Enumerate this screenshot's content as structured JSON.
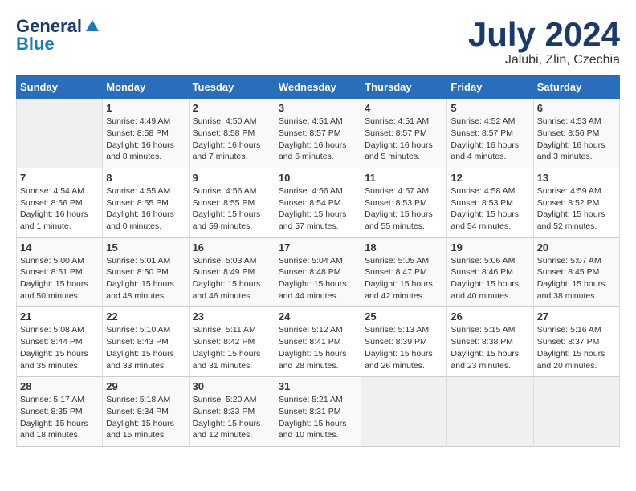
{
  "logo": {
    "general": "General",
    "blue": "Blue"
  },
  "title": "July 2024",
  "location": "Jalubi, Zlin, Czechia",
  "days_of_week": [
    "Sunday",
    "Monday",
    "Tuesday",
    "Wednesday",
    "Thursday",
    "Friday",
    "Saturday"
  ],
  "weeks": [
    [
      {
        "day": "",
        "info": ""
      },
      {
        "day": "1",
        "info": "Sunrise: 4:49 AM\nSunset: 8:58 PM\nDaylight: 16 hours\nand 8 minutes."
      },
      {
        "day": "2",
        "info": "Sunrise: 4:50 AM\nSunset: 8:58 PM\nDaylight: 16 hours\nand 7 minutes."
      },
      {
        "day": "3",
        "info": "Sunrise: 4:51 AM\nSunset: 8:57 PM\nDaylight: 16 hours\nand 6 minutes."
      },
      {
        "day": "4",
        "info": "Sunrise: 4:51 AM\nSunset: 8:57 PM\nDaylight: 16 hours\nand 5 minutes."
      },
      {
        "day": "5",
        "info": "Sunrise: 4:52 AM\nSunset: 8:57 PM\nDaylight: 16 hours\nand 4 minutes."
      },
      {
        "day": "6",
        "info": "Sunrise: 4:53 AM\nSunset: 8:56 PM\nDaylight: 16 hours\nand 3 minutes."
      }
    ],
    [
      {
        "day": "7",
        "info": "Sunrise: 4:54 AM\nSunset: 8:56 PM\nDaylight: 16 hours\nand 1 minute."
      },
      {
        "day": "8",
        "info": "Sunrise: 4:55 AM\nSunset: 8:55 PM\nDaylight: 16 hours\nand 0 minutes."
      },
      {
        "day": "9",
        "info": "Sunrise: 4:56 AM\nSunset: 8:55 PM\nDaylight: 15 hours\nand 59 minutes."
      },
      {
        "day": "10",
        "info": "Sunrise: 4:56 AM\nSunset: 8:54 PM\nDaylight: 15 hours\nand 57 minutes."
      },
      {
        "day": "11",
        "info": "Sunrise: 4:57 AM\nSunset: 8:53 PM\nDaylight: 15 hours\nand 55 minutes."
      },
      {
        "day": "12",
        "info": "Sunrise: 4:58 AM\nSunset: 8:53 PM\nDaylight: 15 hours\nand 54 minutes."
      },
      {
        "day": "13",
        "info": "Sunrise: 4:59 AM\nSunset: 8:52 PM\nDaylight: 15 hours\nand 52 minutes."
      }
    ],
    [
      {
        "day": "14",
        "info": "Sunrise: 5:00 AM\nSunset: 8:51 PM\nDaylight: 15 hours\nand 50 minutes."
      },
      {
        "day": "15",
        "info": "Sunrise: 5:01 AM\nSunset: 8:50 PM\nDaylight: 15 hours\nand 48 minutes."
      },
      {
        "day": "16",
        "info": "Sunrise: 5:03 AM\nSunset: 8:49 PM\nDaylight: 15 hours\nand 46 minutes."
      },
      {
        "day": "17",
        "info": "Sunrise: 5:04 AM\nSunset: 8:48 PM\nDaylight: 15 hours\nand 44 minutes."
      },
      {
        "day": "18",
        "info": "Sunrise: 5:05 AM\nSunset: 8:47 PM\nDaylight: 15 hours\nand 42 minutes."
      },
      {
        "day": "19",
        "info": "Sunrise: 5:06 AM\nSunset: 8:46 PM\nDaylight: 15 hours\nand 40 minutes."
      },
      {
        "day": "20",
        "info": "Sunrise: 5:07 AM\nSunset: 8:45 PM\nDaylight: 15 hours\nand 38 minutes."
      }
    ],
    [
      {
        "day": "21",
        "info": "Sunrise: 5:08 AM\nSunset: 8:44 PM\nDaylight: 15 hours\nand 35 minutes."
      },
      {
        "day": "22",
        "info": "Sunrise: 5:10 AM\nSunset: 8:43 PM\nDaylight: 15 hours\nand 33 minutes."
      },
      {
        "day": "23",
        "info": "Sunrise: 5:11 AM\nSunset: 8:42 PM\nDaylight: 15 hours\nand 31 minutes."
      },
      {
        "day": "24",
        "info": "Sunrise: 5:12 AM\nSunset: 8:41 PM\nDaylight: 15 hours\nand 28 minutes."
      },
      {
        "day": "25",
        "info": "Sunrise: 5:13 AM\nSunset: 8:39 PM\nDaylight: 15 hours\nand 26 minutes."
      },
      {
        "day": "26",
        "info": "Sunrise: 5:15 AM\nSunset: 8:38 PM\nDaylight: 15 hours\nand 23 minutes."
      },
      {
        "day": "27",
        "info": "Sunrise: 5:16 AM\nSunset: 8:37 PM\nDaylight: 15 hours\nand 20 minutes."
      }
    ],
    [
      {
        "day": "28",
        "info": "Sunrise: 5:17 AM\nSunset: 8:35 PM\nDaylight: 15 hours\nand 18 minutes."
      },
      {
        "day": "29",
        "info": "Sunrise: 5:18 AM\nSunset: 8:34 PM\nDaylight: 15 hours\nand 15 minutes."
      },
      {
        "day": "30",
        "info": "Sunrise: 5:20 AM\nSunset: 8:33 PM\nDaylight: 15 hours\nand 12 minutes."
      },
      {
        "day": "31",
        "info": "Sunrise: 5:21 AM\nSunset: 8:31 PM\nDaylight: 15 hours\nand 10 minutes."
      },
      {
        "day": "",
        "info": ""
      },
      {
        "day": "",
        "info": ""
      },
      {
        "day": "",
        "info": ""
      }
    ]
  ]
}
